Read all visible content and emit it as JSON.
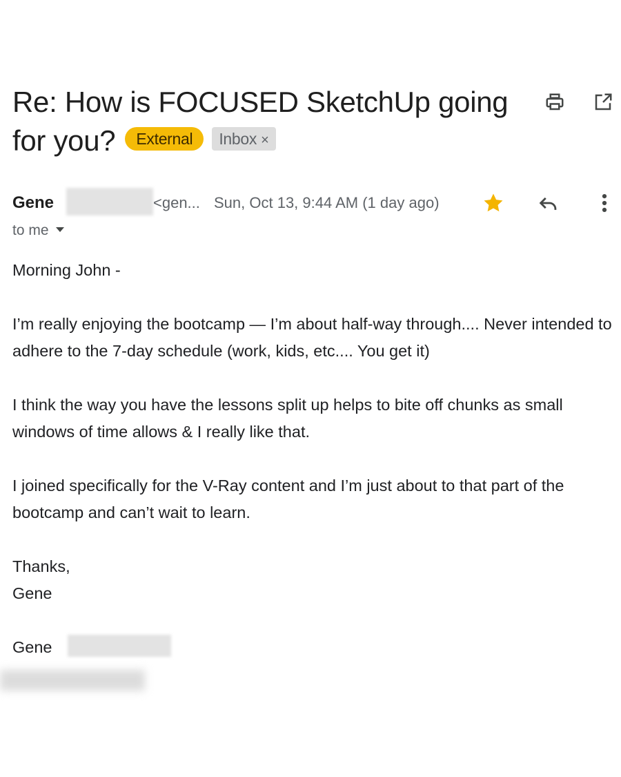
{
  "email": {
    "subject": "Re: How is FOCUSED SketchUp going for you?",
    "labels": {
      "external": "External",
      "inbox": "Inbox",
      "inbox_close": "×"
    },
    "sender": {
      "name": "Gene",
      "email_truncated": "<gen...",
      "date": "Sun, Oct 13, 9:44 AM (1 day ago)",
      "starred": true
    },
    "recipient": "to me",
    "body": {
      "greeting": "Morning John -",
      "paragraph_1": "I’m really enjoying the bootcamp — I’m about half-way through.... Never intended to adhere to the 7-day schedule (work, kids, etc.... You get it)",
      "paragraph_2": "I think the way you have the lessons split up helps to bite off chunks as small windows of time allows & I really like that.",
      "paragraph_3": "I joined specifically for the V-Ray content and I’m just about to that part of the bootcamp and can’t wait to learn.",
      "closing": "Thanks,",
      "signoff": "Gene",
      "signature_name": "Gene"
    }
  },
  "icons": {
    "print": "print-icon",
    "popout": "open-in-new-window-icon",
    "star": "star-icon",
    "reply": "reply-icon",
    "more": "more-vert-icon"
  },
  "colors": {
    "external_chip": "#f5bb07",
    "inbox_chip": "#dddddd",
    "star": "#f4b400",
    "secondary_text": "#5f6368"
  }
}
